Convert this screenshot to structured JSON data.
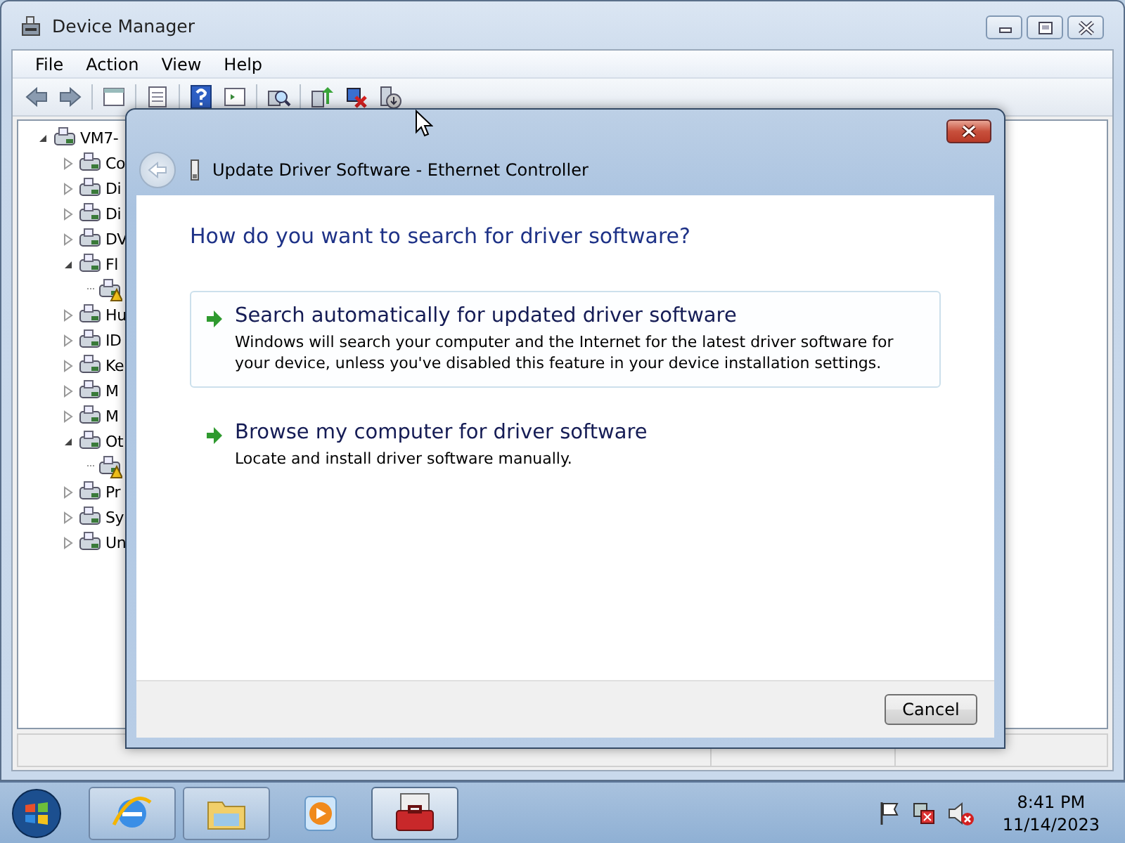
{
  "window": {
    "title": "Device Manager"
  },
  "menu": [
    "File",
    "Action",
    "View",
    "Help"
  ],
  "tree": {
    "label": "VM7-",
    "expanded": true,
    "children": [
      {
        "label": "Co",
        "expanded": false
      },
      {
        "label": "Di",
        "expanded": false
      },
      {
        "label": "Di",
        "expanded": false
      },
      {
        "label": "DV",
        "expanded": false
      },
      {
        "label": "Fl",
        "expanded": true,
        "children": [
          {
            "warning": true
          }
        ]
      },
      {
        "label": "Hu",
        "expanded": false
      },
      {
        "label": "ID",
        "expanded": false
      },
      {
        "label": "Ke",
        "expanded": false
      },
      {
        "label": "M",
        "expanded": false
      },
      {
        "label": "M",
        "expanded": false
      },
      {
        "label": "Ot",
        "expanded": true,
        "children": [
          {
            "warning": true
          }
        ]
      },
      {
        "label": "Pr",
        "expanded": false
      },
      {
        "label": "Sy",
        "expanded": false
      },
      {
        "label": "Un",
        "expanded": false
      }
    ]
  },
  "dialog": {
    "title": "Update Driver Software - Ethernet Controller",
    "heading": "How do you want to search for driver software?",
    "options": [
      {
        "title": "Search automatically for updated driver software",
        "description": "Windows will search your computer and the Internet for the latest driver software for your device, unless you've disabled this feature in your device installation settings.",
        "selected": true
      },
      {
        "title": "Browse my computer for driver software",
        "description": "Locate and install driver software manually.",
        "selected": false
      }
    ],
    "buttons": [
      "Cancel"
    ]
  },
  "taskbar": {
    "apps": [
      {
        "kind": "browser",
        "selected": false
      },
      {
        "kind": "folder",
        "selected": false
      },
      {
        "kind": "media",
        "selected": false
      },
      {
        "kind": "toolbox",
        "selected": true
      }
    ],
    "time": "8:41 PM",
    "date": "11/14/2023"
  }
}
